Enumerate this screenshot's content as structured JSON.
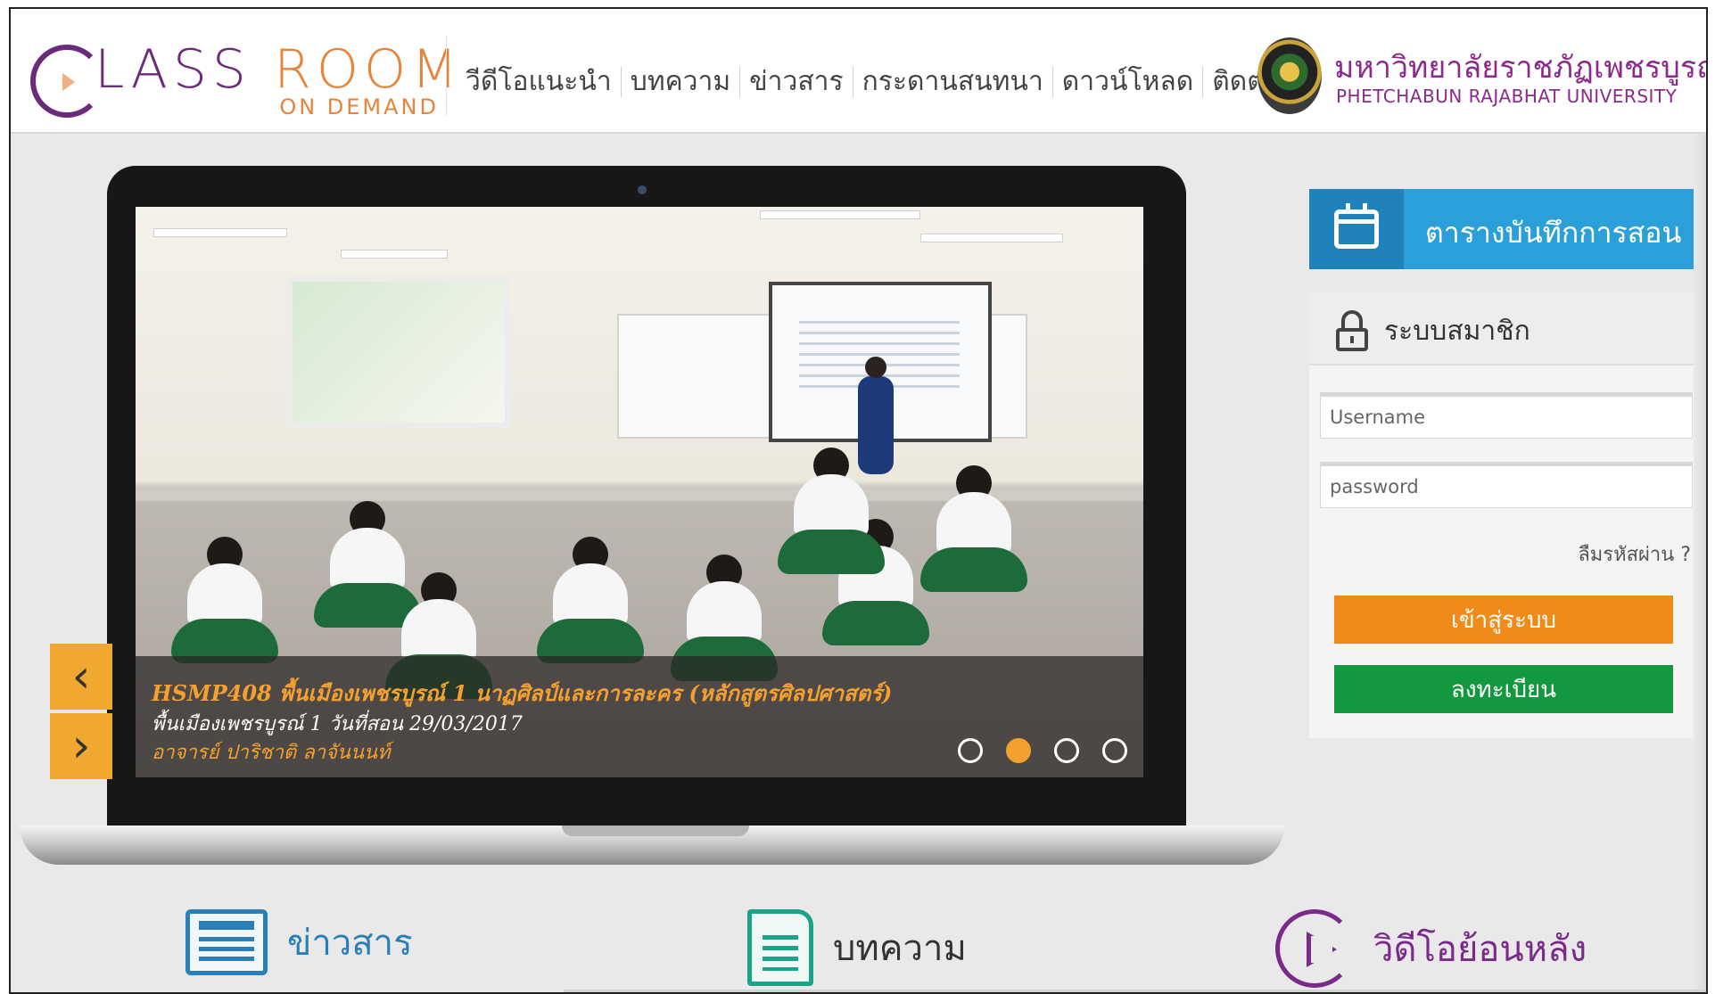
{
  "header": {
    "logo": {
      "main_lass": "LASS",
      "main_room": "ROOM",
      "sub": "ON DEMAND"
    },
    "nav": [
      "วีดีโอแนะนำ",
      "บทความ",
      "ข่าวสาร",
      "กระดานสนทนา",
      "ดาวน์โหลด",
      "ติดต่อเรา"
    ],
    "university": {
      "name_th": "มหาวิทยาลัยราชภัฏเพชรบูรณ์",
      "name_en": "PHETCHABUN RAJABHAT UNIVERSITY"
    }
  },
  "slider": {
    "title": "HSMP408 พื้นเมืองเพชรบูรณ์ 1 นาฏศิลป์และการละคร (หลักสูตรศิลปศาสตร์)",
    "subtitle": "พื้นเมืองเพชรบูรณ์ 1 วันที่สอน 29/03/2017",
    "teacher": "อาจารย์ ปาริชาติ ลาจันนนท์",
    "prev_label": "‹",
    "next_label": "›",
    "active_dot": 2,
    "dot_count": 4
  },
  "schedule": {
    "label": "ตารางบันทึกการสอน"
  },
  "member": {
    "title": "ระบบสมาชิก",
    "username_placeholder": "Username",
    "password_placeholder": "password",
    "forgot": "ลืมรหัสผ่าน ?",
    "login": "เข้าสู่ระบบ",
    "register": "ลงทะเบียน"
  },
  "features": {
    "news": "ข่าวสาร",
    "articles": "บทความ",
    "videos": "วิดีโอย้อนหลัง"
  },
  "colors": {
    "brand_purple": "#6b2a7a",
    "brand_orange": "#e8833a",
    "schedule_blue": "#2b9fd8",
    "login_orange": "#f08a18",
    "register_green": "#12993f"
  }
}
